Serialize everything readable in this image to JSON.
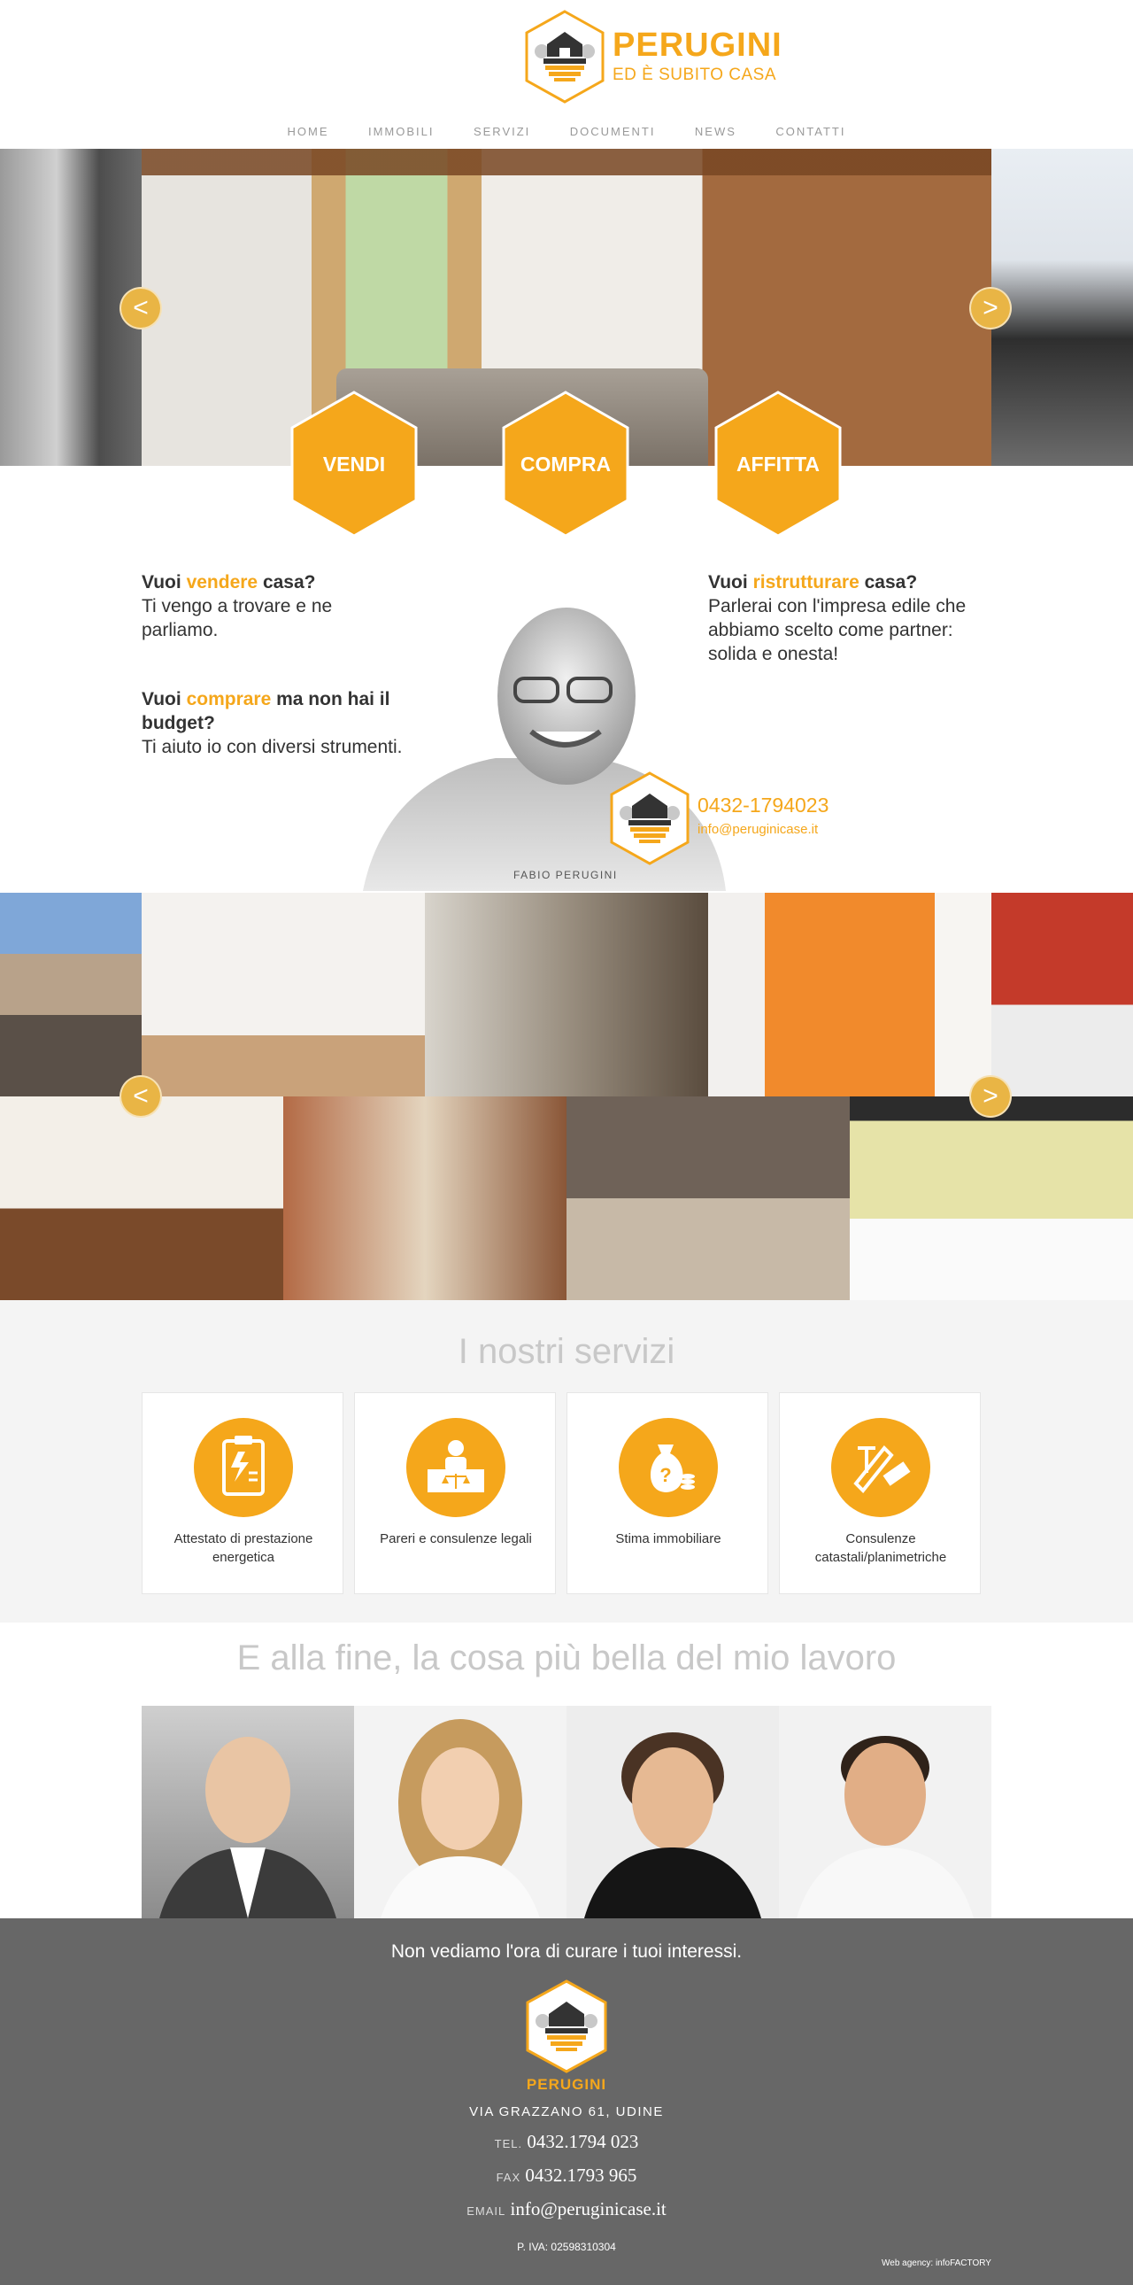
{
  "brand": {
    "name": "PERUGINI",
    "tagline": "ED È SUBITO CASA",
    "accent": "#f5a71b"
  },
  "nav": [
    {
      "label": "HOME"
    },
    {
      "label": "IMMOBILI"
    },
    {
      "label": "SERVIZI"
    },
    {
      "label": "DOCUMENTI"
    },
    {
      "label": "NEWS"
    },
    {
      "label": "CONTATTI"
    }
  ],
  "hero": {
    "prev_label": "<",
    "next_label": ">"
  },
  "cta": [
    {
      "label": "VENDI"
    },
    {
      "label": "COMPRA"
    },
    {
      "label": "AFFITTA"
    }
  ],
  "intro": {
    "sell": {
      "pre": "Vuoi ",
      "hl": "vendere",
      "post": " casa?",
      "body": "Ti vengo a trovare e ne parliamo."
    },
    "buy": {
      "pre": "Vuoi ",
      "hl": "comprare",
      "post": " ma non hai il budget?",
      "body": "Ti aiuto io con diversi strumenti."
    },
    "renovate": {
      "pre": "Vuoi ",
      "hl": "ristrutturare",
      "post": " casa?",
      "body": "Parlerai con l'impresa edile che abbiamo scelto come partner: solida e onesta!"
    }
  },
  "agent": {
    "name": "FABIO PERUGINI",
    "phone": "0432-1794023",
    "email": "info@peruginicase.it"
  },
  "gallery": {
    "prev_label": "<",
    "next_label": ">"
  },
  "services": {
    "title": "I nostri servizi",
    "items": [
      {
        "label": "Attestato di prestazione energetica",
        "icon": "clipboard-energy-icon"
      },
      {
        "label": "Pareri e consulenze legali",
        "icon": "legal-desk-icon"
      },
      {
        "label": "Stima immobiliare",
        "icon": "money-bag-icon"
      },
      {
        "label": "Consulenze catastali/planimetriche",
        "icon": "blueprint-tools-icon"
      }
    ]
  },
  "team": {
    "title": "E alla fine, la cosa più bella del mio lavoro"
  },
  "footer": {
    "slogan": "Non vediamo l'ora di curare i tuoi interessi.",
    "brand": "PERUGINI",
    "address": "VIA GRAZZANO 61, UDINE",
    "tel_label": "TEL.",
    "tel": "0432.1794 023",
    "fax_label": "FAX",
    "fax": "0432.1793 965",
    "email_label": "EMAIL",
    "email": "info@peruginicase.it",
    "vat": "P. IVA: 02598310304",
    "agency": "Web agency: infoFACTORY"
  }
}
